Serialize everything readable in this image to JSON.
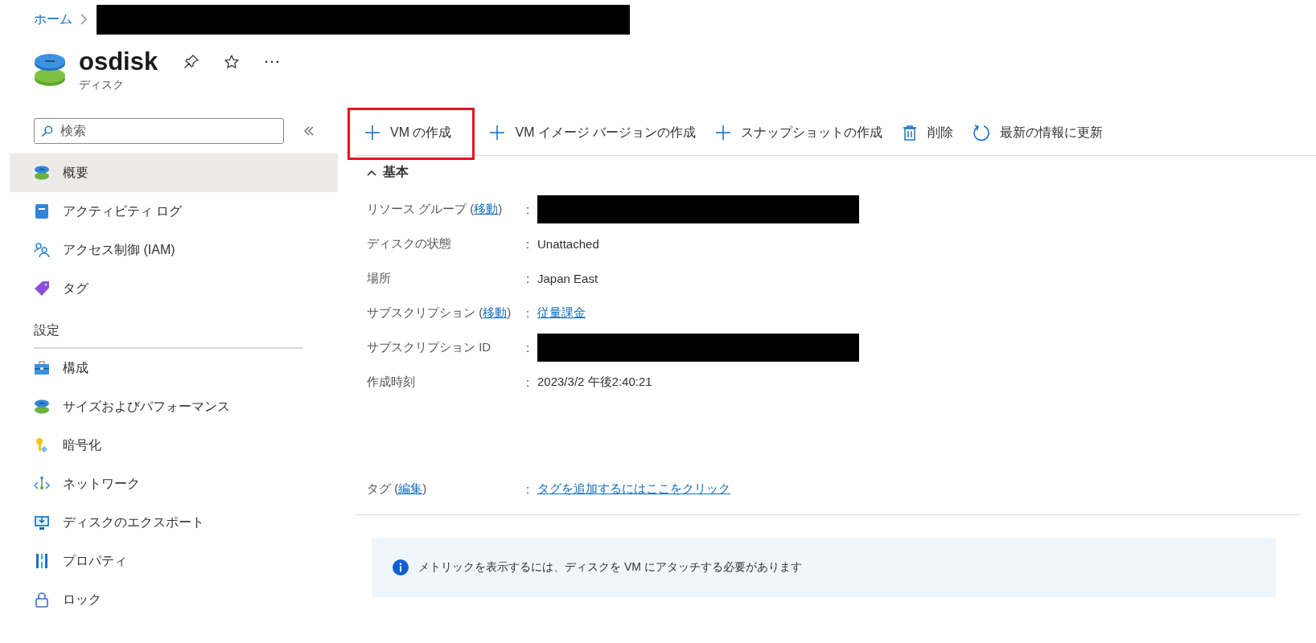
{
  "breadcrumb": {
    "home": "ホーム",
    "current": {
      "kind": "redacted"
    }
  },
  "resource": {
    "name": "osdisk",
    "type": "ディスク"
  },
  "search": {
    "placeholder": "検索"
  },
  "sidebar": {
    "items": [
      {
        "label": "概要",
        "kind": "disk",
        "selected": true
      },
      {
        "label": "アクティビティ ログ",
        "kind": "log",
        "selected": false
      },
      {
        "label": "アクセス制御 (IAM)",
        "kind": "iam",
        "selected": false
      },
      {
        "label": "タグ",
        "kind": "tag",
        "selected": false
      }
    ],
    "sections": [
      {
        "title": "設定",
        "items": [
          {
            "label": "構成",
            "kind": "config",
            "selected": false
          },
          {
            "label": "サイズおよびパフォーマンス",
            "kind": "disk",
            "selected": false
          },
          {
            "label": "暗号化",
            "kind": "key",
            "selected": false
          },
          {
            "label": "ネットワーク",
            "kind": "network",
            "selected": false
          },
          {
            "label": "ディスクのエクスポート",
            "kind": "export",
            "selected": false
          },
          {
            "label": "プロパティ",
            "kind": "properties",
            "selected": false
          },
          {
            "label": "ロック",
            "kind": "lock",
            "selected": false
          }
        ]
      }
    ]
  },
  "toolbar": [
    {
      "label": "VM の作成",
      "kind": "plus",
      "highlighted": true
    },
    {
      "label": "VM イメージ バージョンの作成",
      "kind": "plus",
      "highlighted": false
    },
    {
      "label": "スナップショットの作成",
      "kind": "plus",
      "highlighted": false
    },
    {
      "label": "削除",
      "kind": "delete",
      "highlighted": false
    },
    {
      "label": "最新の情報に更新",
      "kind": "refresh",
      "highlighted": false
    }
  ],
  "essentials": {
    "title": "基本",
    "expanded": true,
    "properties": [
      {
        "label": "リソース グループ (",
        "label_link": "移動",
        "label_suffix": ")",
        "sep": ":",
        "kind": "redacted"
      },
      {
        "label": "ディスクの状態",
        "sep": ":",
        "kind": "text",
        "value": "Unattached"
      },
      {
        "label": "場所",
        "sep": ":",
        "kind": "text",
        "value": "Japan East"
      },
      {
        "label": "サブスクリプション (",
        "label_link": "移動",
        "label_suffix": ")",
        "sep": ":",
        "kind": "link",
        "value": "従量課金"
      },
      {
        "label": "サブスクリプション ID",
        "sep": ":",
        "kind": "redacted"
      },
      {
        "label": "作成時刻",
        "sep": ":",
        "kind": "text",
        "value": "2023/3/2 午後2:40:21"
      }
    ],
    "tags": {
      "label": "タグ (",
      "label_link": "編集",
      "label_suffix": ")",
      "sep": ":",
      "kind": "link",
      "value": "タグを追加するにはここをクリック"
    }
  },
  "info": {
    "message": "メトリックを表示するには、ディスクを VM にアタッチする必要があります"
  }
}
